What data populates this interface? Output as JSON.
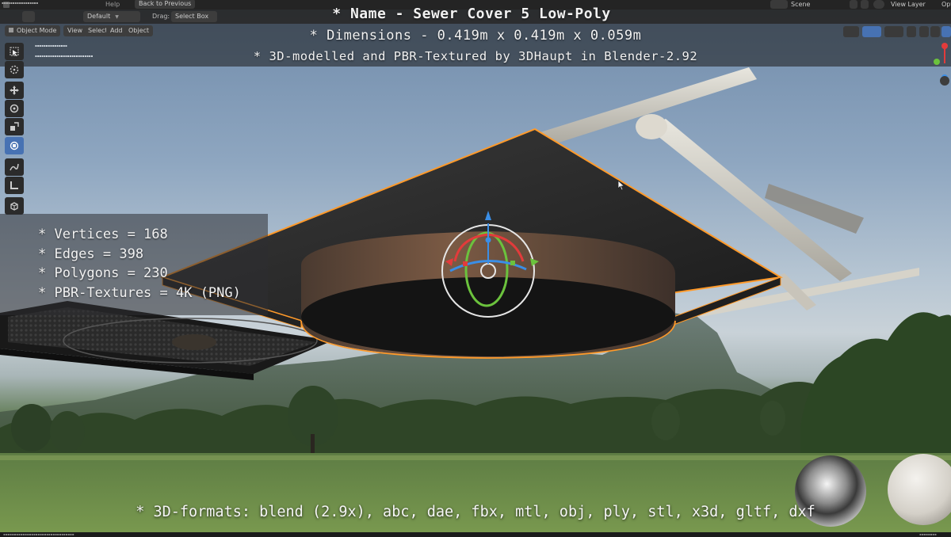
{
  "menu": {
    "help": "Help",
    "back_to_previous": "Back to Previous",
    "scene_label": "Scene",
    "view_layer_label": "View Layer"
  },
  "header": {
    "orientation_value": "Default",
    "drag_label": "Drag:",
    "drag_value": "Select Box"
  },
  "viewport_header": {
    "mode": "Object Mode",
    "view": "View",
    "select": "Select",
    "add": "Add",
    "object": "Object"
  },
  "overlay": {
    "name_line": "* Name - Sewer Cover 5 Low-Poly",
    "dimensions_line": "* Dimensions -  0.419m x 0.419m x 0.059m",
    "credit_line": "* 3D-modelled and PBR-Textured by 3DHaupt in Blender-2.92",
    "stats": [
      "* Vertices = 168",
      "* Edges = 398",
      "* Polygons = 230",
      "* PBR-Textures = 4K (PNG)"
    ],
    "formats_line": "* 3D-formats: blend (2.9x), abc, dae, fbx, mtl, obj, ply, stl, x3d, gltf, dxf"
  },
  "tools": [
    {
      "icon": "select-box-icon",
      "active": false
    },
    {
      "icon": "cursor-icon",
      "active": false
    },
    {
      "icon": "move-icon",
      "active": false
    },
    {
      "icon": "rotate-icon",
      "active": false
    },
    {
      "icon": "scale-icon",
      "active": false
    },
    {
      "icon": "transform-icon",
      "active": true
    },
    {
      "icon": "annotate-icon",
      "active": false
    },
    {
      "icon": "measure-icon",
      "active": false
    },
    {
      "icon": "add-cube-icon",
      "active": false
    }
  ],
  "colors": {
    "selection_outline": "#ff9a2a",
    "active_tool": "#4772b3",
    "gizmo_red": "#e23b3b",
    "gizmo_green": "#6bc23d",
    "gizmo_blue": "#3a8ee6"
  }
}
